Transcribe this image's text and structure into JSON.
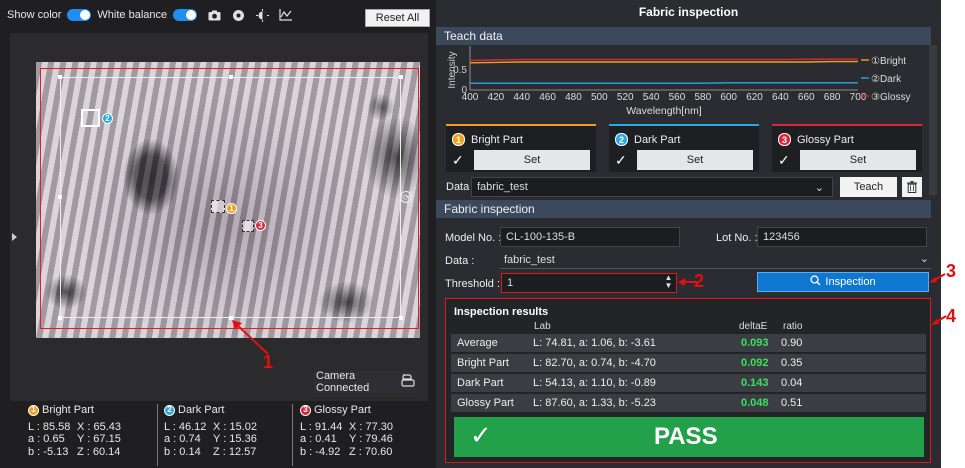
{
  "toolbar": {
    "show_color": "Show color",
    "white_balance": "White balance",
    "reset_all": "Reset All"
  },
  "camera_status": "Camera Connected",
  "colors": {
    "bright": "#f0a020",
    "dark": "#2aa8e0",
    "glossy": "#d8283a",
    "accent": "#0e78d0",
    "pass": "#22a04a"
  },
  "icons": [
    "camera-icon",
    "settings-icon",
    "brightness-icon",
    "graph-icon",
    "camera-connected-icon",
    "trash-icon",
    "search-icon",
    "chevron-down-icon",
    "spin-up-icon",
    "spin-down-icon",
    "check-icon"
  ],
  "stats": [
    {
      "num": "1",
      "name": "Bright Part",
      "L": "L : 85.58",
      "X": "X : 65.43",
      "a": "a : 0.65",
      "Y": "Y : 67.15",
      "b": "b : -5.13",
      "Z": "Z : 60.14"
    },
    {
      "num": "2",
      "name": "Dark Part",
      "L": "L : 46.12",
      "X": "X : 15.02",
      "a": "a : 0.74",
      "Y": "Y : 15.36",
      "b": "b : 0.14",
      "Z": "Z : 12.57"
    },
    {
      "num": "3",
      "name": "Glossy Part",
      "L": "L : 91.44",
      "X": "X : 77.30",
      "a": "a : 0.41",
      "Y": "Y : 79.46",
      "b": "b : -4.92",
      "Z": "Z : 70.60"
    }
  ],
  "annotations": [
    "1",
    "2",
    "3",
    "4"
  ],
  "panel": {
    "title": "Fabric inspection",
    "teach_header": "Teach data",
    "inspection_header": "Fabric inspection"
  },
  "chart_data": {
    "type": "line",
    "ylabel": "Intensity",
    "xlabel": "Wavelength[nm]",
    "x_ticks": [
      "400",
      "420",
      "440",
      "460",
      "480",
      "500",
      "520",
      "540",
      "560",
      "580",
      "600",
      "620",
      "640",
      "660",
      "680",
      "700"
    ],
    "y_ticks": [
      "0",
      "0.5"
    ],
    "ylim": [
      0,
      1
    ],
    "xlim": [
      400,
      700
    ],
    "series": [
      {
        "name": "①Bright",
        "color": "#f0a020",
        "y": [
          0.68,
          0.69,
          0.7,
          0.7,
          0.7,
          0.7,
          0.7,
          0.7,
          0.7,
          0.7,
          0.7,
          0.7,
          0.7,
          0.7,
          0.71,
          0.71
        ]
      },
      {
        "name": "②Dark",
        "color": "#2aa8e0",
        "y": [
          0.17,
          0.17,
          0.17,
          0.17,
          0.17,
          0.17,
          0.17,
          0.17,
          0.17,
          0.17,
          0.18,
          0.18,
          0.18,
          0.18,
          0.18,
          0.18
        ]
      },
      {
        "name": "③Glossy",
        "color": "#d8283a",
        "y": [
          0.74,
          0.75,
          0.76,
          0.76,
          0.76,
          0.76,
          0.76,
          0.76,
          0.76,
          0.76,
          0.76,
          0.76,
          0.76,
          0.77,
          0.77,
          0.77
        ]
      }
    ]
  },
  "teach_cards": [
    {
      "num": "1",
      "label": "Bright Part",
      "set": "Set"
    },
    {
      "num": "2",
      "label": "Dark Part",
      "set": "Set"
    },
    {
      "num": "3",
      "label": "Glossy Part",
      "set": "Set"
    }
  ],
  "data_select": {
    "label": "Data",
    "value": "fabric_test",
    "teach": "Teach"
  },
  "form": {
    "model_label": "Model No. :",
    "model_value": "CL-100-135-B",
    "lot_label": "Lot No. :",
    "lot_value": "123456",
    "data_label": "Data :",
    "data_value": "fabric_test",
    "threshold_label": "Threshold :",
    "threshold_value": "1",
    "inspection_button": "Inspection"
  },
  "results": {
    "title": "Inspection results",
    "col_lab": "Lab",
    "col_delta": "deltaE",
    "col_ratio": "ratio",
    "rows": [
      {
        "name": "Average",
        "lab": "L: 74.81, a: 1.06, b: -3.61",
        "delta": "0.093",
        "ratio": "0.90"
      },
      {
        "name": "Bright Part",
        "lab": "L: 82.70, a: 0.74, b: -4.70",
        "delta": "0.092",
        "ratio": "0.35"
      },
      {
        "name": "Dark Part",
        "lab": "L: 54.13, a: 1.10, b: -0.89",
        "delta": "0.143",
        "ratio": "0.04"
      },
      {
        "name": "Glossy Part",
        "lab": "L: 87.60, a: 1.33, b: -5.23",
        "delta": "0.048",
        "ratio": "0.51"
      }
    ],
    "verdict": "PASS"
  }
}
